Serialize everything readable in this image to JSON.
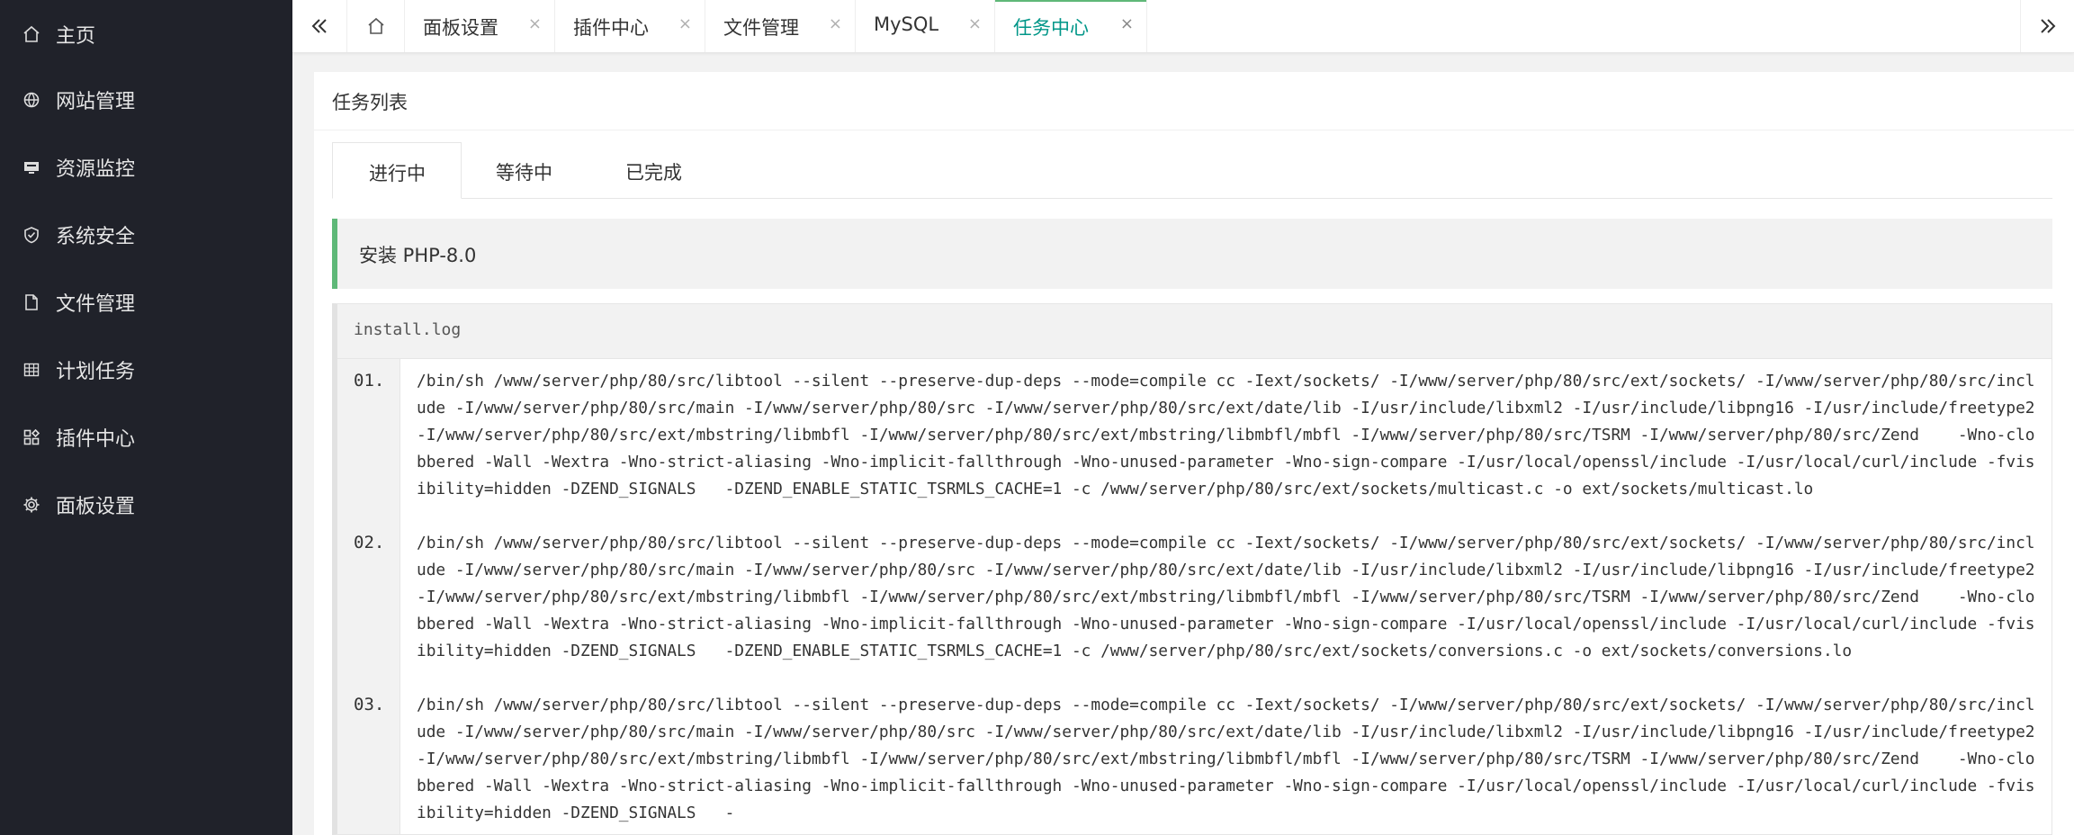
{
  "sidebar": {
    "items": [
      {
        "label": "主页",
        "icon": "home-icon"
      },
      {
        "label": "网站管理",
        "icon": "globe-icon"
      },
      {
        "label": "资源监控",
        "icon": "monitor-icon"
      },
      {
        "label": "系统安全",
        "icon": "shield-icon"
      },
      {
        "label": "文件管理",
        "icon": "file-icon"
      },
      {
        "label": "计划任务",
        "icon": "calendar-grid-icon"
      },
      {
        "label": "插件中心",
        "icon": "plugins-icon"
      },
      {
        "label": "面板设置",
        "icon": "gear-icon"
      }
    ]
  },
  "topbar": {
    "prev_icon": "double-chevron-left-icon",
    "home_icon": "home-icon",
    "next_icon": "double-chevron-right-icon",
    "tabs": [
      {
        "label": "面板设置",
        "close": "×"
      },
      {
        "label": "插件中心",
        "close": "×"
      },
      {
        "label": "文件管理",
        "close": "×"
      },
      {
        "label": "MySQL",
        "close": "×"
      },
      {
        "label": "任务中心",
        "close": "×",
        "active": true
      }
    ],
    "accent_color": "#5FB878"
  },
  "main": {
    "card_title": "任务列表",
    "subtabs": [
      {
        "label": "进行中",
        "active": true
      },
      {
        "label": "等待中"
      },
      {
        "label": "已完成"
      }
    ],
    "task_title": "安装 PHP-8.0",
    "log": {
      "filename": "install.log",
      "lines": [
        {
          "num": "01.",
          "text": "/bin/sh /www/server/php/80/src/libtool --silent --preserve-dup-deps --mode=compile cc -Iext/sockets/ -I/www/server/php/80/src/ext/sockets/ -I/www/server/php/80/src/include -I/www/server/php/80/src/main -I/www/server/php/80/src -I/www/server/php/80/src/ext/date/lib -I/usr/include/libxml2 -I/usr/include/libpng16 -I/usr/include/freetype2 -I/www/server/php/80/src/ext/mbstring/libmbfl -I/www/server/php/80/src/ext/mbstring/libmbfl/mbfl -I/www/server/php/80/src/TSRM -I/www/server/php/80/src/Zend    -Wno-clobbered -Wall -Wextra -Wno-strict-aliasing -Wno-implicit-fallthrough -Wno-unused-parameter -Wno-sign-compare -I/usr/local/openssl/include -I/usr/local/curl/include -fvisibility=hidden -DZEND_SIGNALS   -DZEND_ENABLE_STATIC_TSRMLS_CACHE=1 -c /www/server/php/80/src/ext/sockets/multicast.c -o ext/sockets/multicast.lo"
        },
        {
          "num": "02.",
          "text": "/bin/sh /www/server/php/80/src/libtool --silent --preserve-dup-deps --mode=compile cc -Iext/sockets/ -I/www/server/php/80/src/ext/sockets/ -I/www/server/php/80/src/include -I/www/server/php/80/src/main -I/www/server/php/80/src -I/www/server/php/80/src/ext/date/lib -I/usr/include/libxml2 -I/usr/include/libpng16 -I/usr/include/freetype2 -I/www/server/php/80/src/ext/mbstring/libmbfl -I/www/server/php/80/src/ext/mbstring/libmbfl/mbfl -I/www/server/php/80/src/TSRM -I/www/server/php/80/src/Zend    -Wno-clobbered -Wall -Wextra -Wno-strict-aliasing -Wno-implicit-fallthrough -Wno-unused-parameter -Wno-sign-compare -I/usr/local/openssl/include -I/usr/local/curl/include -fvisibility=hidden -DZEND_SIGNALS   -DZEND_ENABLE_STATIC_TSRMLS_CACHE=1 -c /www/server/php/80/src/ext/sockets/conversions.c -o ext/sockets/conversions.lo"
        },
        {
          "num": "03.",
          "text": "/bin/sh /www/server/php/80/src/libtool --silent --preserve-dup-deps --mode=compile cc -Iext/sockets/ -I/www/server/php/80/src/ext/sockets/ -I/www/server/php/80/src/include -I/www/server/php/80/src/main -I/www/server/php/80/src -I/www/server/php/80/src/ext/date/lib -I/usr/include/libxml2 -I/usr/include/libpng16 -I/usr/include/freetype2 -I/www/server/php/80/src/ext/mbstring/libmbfl -I/www/server/php/80/src/ext/mbstring/libmbfl/mbfl -I/www/server/php/80/src/TSRM -I/www/server/php/80/src/Zend    -Wno-clobbered -Wall -Wextra -Wno-strict-aliasing -Wno-implicit-fallthrough -Wno-unused-parameter -Wno-sign-compare -I/usr/local/openssl/include -I/usr/local/curl/include -fvisibility=hidden -DZEND_SIGNALS   -"
        }
      ]
    }
  }
}
